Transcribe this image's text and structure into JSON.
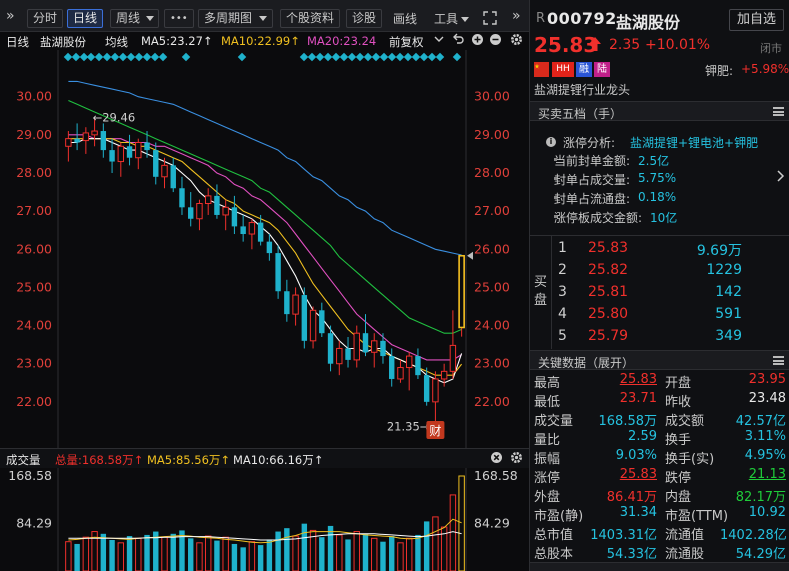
{
  "toolbar": {
    "collapse": "»",
    "intraday": "分时",
    "daily": "日线",
    "weekly": "周线",
    "more_icon": "•••",
    "multi_period": "多周期图",
    "profile": "个股资料",
    "diagnose": "诊股",
    "draw": "画线",
    "tools": "工具",
    "expand_icon": "expand-icon"
  },
  "chart_head": {
    "period": "日线",
    "name": "盐湖股份",
    "avg": "均线",
    "ma5": "MA5:23.27↑",
    "ma10": "MA10:22.99↑",
    "ma20": "MA20:23.24",
    "adjust": "前复权"
  },
  "price_axis": [
    "30.00",
    "29.00",
    "28.00",
    "27.00",
    "26.00",
    "25.00",
    "24.00",
    "23.00",
    "22.00"
  ],
  "annotations": {
    "high": "←29.46",
    "low": "21.35→",
    "finance_badge": "财"
  },
  "volume_head": {
    "label": "成交量",
    "total": "总量:168.58万↑",
    "ma5": "MA5:85.56万↑",
    "ma10": "MA10:66.16万↑"
  },
  "volume_axis": [
    "168.58",
    "84.29"
  ],
  "stock": {
    "market": "R",
    "code": "000792",
    "name": "盐湖股份",
    "add_button": "加自选",
    "price": "25.83",
    "change": "2.35",
    "change_pct": "+10.01%",
    "status": "闭市",
    "tags": [
      "CN",
      "HH",
      "融",
      "陆"
    ],
    "sector_change_label": "钾肥:",
    "sector_change": "+5.98%",
    "concept": "盐湖提锂行业龙头"
  },
  "limit_analysis": {
    "title": "买卖五档（手）",
    "label": "涨停分析:",
    "concepts": "盐湖提锂+锂电池+钾肥",
    "rows": [
      {
        "k": "当前封单金额:",
        "v": "2.5亿"
      },
      {
        "k": "封单占成交量:",
        "v": "5.75%"
      },
      {
        "k": "封单占流通盘:",
        "v": "0.18%"
      },
      {
        "k": "涨停板成交金额:",
        "v": "10亿"
      }
    ]
  },
  "order_book": {
    "side_label": "买盘",
    "rows": [
      {
        "i": "1",
        "p": "25.83",
        "v": "9.69万"
      },
      {
        "i": "2",
        "p": "25.82",
        "v": "1229"
      },
      {
        "i": "3",
        "p": "25.81",
        "v": "142"
      },
      {
        "i": "4",
        "p": "25.80",
        "v": "591"
      },
      {
        "i": "5",
        "p": "25.79",
        "v": "349"
      }
    ]
  },
  "key_data": {
    "title": "关键数据（展开）",
    "rows": [
      {
        "k1": "最高",
        "v1": "25.83",
        "c1": "red",
        "k2": "开盘",
        "v2": "23.95",
        "c2": "red"
      },
      {
        "k1": "最低",
        "v1": "23.71",
        "c1": "red",
        "k2": "昨收",
        "v2": "23.48",
        "c2": "white"
      },
      {
        "k1": "成交量",
        "v1": "168.58万",
        "c1": "cyan",
        "k2": "成交额",
        "v2": "42.57亿",
        "c2": "cyan"
      },
      {
        "k1": "量比",
        "v1": "2.59",
        "c1": "cyan",
        "k2": "换手",
        "v2": "3.11%",
        "c2": "cyan"
      },
      {
        "k1": "振幅",
        "v1": "9.03%",
        "c1": "cyan",
        "k2": "换手(实)",
        "v2": "4.95%",
        "c2": "cyan"
      },
      {
        "k1": "涨停",
        "v1": "25.83",
        "c1": "red",
        "k2": "跌停",
        "v2": "21.13",
        "c2": "green"
      },
      {
        "k1": "外盘",
        "v1": "86.41万",
        "c1": "red",
        "k2": "内盘",
        "v2": "82.17万",
        "c2": "green"
      },
      {
        "k1": "市盈(静)",
        "v1": "31.34",
        "c1": "cyan",
        "k2": "市盈(TTM)",
        "v2": "10.92",
        "c2": "cyan"
      },
      {
        "k1": "总市值",
        "v1": "1403.31亿",
        "c1": "cyan",
        "k2": "流通值",
        "v2": "1402.28亿",
        "c2": "cyan"
      },
      {
        "k1": "总股本",
        "v1": "54.33亿",
        "c1": "cyan",
        "k2": "流通股",
        "v2": "54.29亿",
        "c2": "cyan"
      }
    ]
  },
  "chart_data": {
    "type": "candlestick",
    "ylim": [
      21.0,
      30.7
    ],
    "candles": [
      {
        "o": 28.7,
        "h": 29.1,
        "l": 28.3,
        "c": 28.9
      },
      {
        "o": 28.9,
        "h": 29.3,
        "l": 28.6,
        "c": 28.8
      },
      {
        "o": 28.85,
        "h": 29.2,
        "l": 28.5,
        "c": 29.05
      },
      {
        "o": 29.0,
        "h": 29.46,
        "l": 28.7,
        "c": 29.1
      },
      {
        "o": 29.1,
        "h": 29.3,
        "l": 28.4,
        "c": 28.6
      },
      {
        "o": 28.6,
        "h": 28.9,
        "l": 28.0,
        "c": 28.3
      },
      {
        "o": 28.3,
        "h": 28.8,
        "l": 27.9,
        "c": 28.7
      },
      {
        "o": 28.7,
        "h": 29.0,
        "l": 28.2,
        "c": 28.4
      },
      {
        "o": 28.4,
        "h": 28.9,
        "l": 28.1,
        "c": 28.8
      },
      {
        "o": 28.8,
        "h": 29.1,
        "l": 28.4,
        "c": 28.6
      },
      {
        "o": 28.6,
        "h": 28.8,
        "l": 27.7,
        "c": 27.9
      },
      {
        "o": 27.9,
        "h": 28.4,
        "l": 27.6,
        "c": 28.2
      },
      {
        "o": 28.2,
        "h": 28.4,
        "l": 27.5,
        "c": 27.6
      },
      {
        "o": 27.6,
        "h": 27.9,
        "l": 26.9,
        "c": 27.1
      },
      {
        "o": 27.1,
        "h": 27.5,
        "l": 26.6,
        "c": 26.8
      },
      {
        "o": 26.8,
        "h": 27.3,
        "l": 26.5,
        "c": 27.2
      },
      {
        "o": 27.2,
        "h": 27.6,
        "l": 26.9,
        "c": 27.4
      },
      {
        "o": 27.4,
        "h": 27.7,
        "l": 26.8,
        "c": 26.9
      },
      {
        "o": 26.9,
        "h": 27.3,
        "l": 26.5,
        "c": 27.1
      },
      {
        "o": 27.1,
        "h": 27.4,
        "l": 26.4,
        "c": 26.6
      },
      {
        "o": 26.6,
        "h": 26.9,
        "l": 26.2,
        "c": 26.4
      },
      {
        "o": 26.4,
        "h": 26.8,
        "l": 26.0,
        "c": 26.7
      },
      {
        "o": 26.7,
        "h": 26.9,
        "l": 26.1,
        "c": 26.2
      },
      {
        "o": 26.2,
        "h": 26.4,
        "l": 25.7,
        "c": 25.9
      },
      {
        "o": 25.9,
        "h": 26.1,
        "l": 24.7,
        "c": 24.9
      },
      {
        "o": 24.9,
        "h": 25.2,
        "l": 24.1,
        "c": 24.3
      },
      {
        "o": 24.3,
        "h": 25.0,
        "l": 24.0,
        "c": 24.8
      },
      {
        "o": 24.8,
        "h": 25.0,
        "l": 23.4,
        "c": 23.6
      },
      {
        "o": 23.6,
        "h": 24.5,
        "l": 23.4,
        "c": 24.4
      },
      {
        "o": 24.4,
        "h": 24.6,
        "l": 23.7,
        "c": 23.8
      },
      {
        "o": 23.8,
        "h": 24.0,
        "l": 22.8,
        "c": 23.0
      },
      {
        "o": 23.0,
        "h": 23.6,
        "l": 22.7,
        "c": 23.4
      },
      {
        "o": 23.4,
        "h": 23.7,
        "l": 22.9,
        "c": 23.1
      },
      {
        "o": 23.1,
        "h": 24.0,
        "l": 22.9,
        "c": 23.8
      },
      {
        "o": 23.8,
        "h": 24.3,
        "l": 23.2,
        "c": 23.3
      },
      {
        "o": 23.3,
        "h": 23.8,
        "l": 22.9,
        "c": 23.6
      },
      {
        "o": 23.6,
        "h": 23.8,
        "l": 23.0,
        "c": 23.2
      },
      {
        "o": 23.2,
        "h": 23.4,
        "l": 22.4,
        "c": 22.6
      },
      {
        "o": 22.6,
        "h": 23.1,
        "l": 22.5,
        "c": 22.9
      },
      {
        "o": 22.9,
        "h": 23.3,
        "l": 22.3,
        "c": 23.2
      },
      {
        "o": 23.2,
        "h": 23.4,
        "l": 22.6,
        "c": 22.7
      },
      {
        "o": 22.7,
        "h": 22.9,
        "l": 21.9,
        "c": 22.0
      },
      {
        "o": 22.0,
        "h": 22.8,
        "l": 21.35,
        "c": 22.6
      },
      {
        "o": 22.6,
        "h": 23.0,
        "l": 22.4,
        "c": 22.8
      },
      {
        "o": 22.8,
        "h": 24.4,
        "l": 22.6,
        "c": 23.48
      },
      {
        "o": 23.95,
        "h": 25.83,
        "l": 23.71,
        "c": 25.83
      }
    ],
    "ma_series": [
      {
        "name": "MA5",
        "color": "#ffffff",
        "values": [
          28.8,
          28.8,
          28.9,
          28.9,
          28.9,
          28.8,
          28.7,
          28.6,
          28.6,
          28.5,
          28.4,
          28.3,
          28.2,
          28.0,
          27.8,
          27.5,
          27.3,
          27.2,
          27.1,
          27.0,
          26.9,
          26.8,
          26.6,
          26.4,
          26.1,
          25.7,
          25.3,
          24.8,
          24.4,
          24.2,
          23.9,
          23.6,
          23.4,
          23.4,
          23.3,
          23.4,
          23.4,
          23.2,
          23.1,
          23.0,
          22.9,
          22.7,
          22.6,
          22.5,
          22.6,
          23.27
        ]
      },
      {
        "name": "MA10",
        "color": "#f0c020",
        "values": [
          28.9,
          28.9,
          28.9,
          28.9,
          28.9,
          28.9,
          28.8,
          28.8,
          28.7,
          28.7,
          28.6,
          28.5,
          28.4,
          28.3,
          28.1,
          27.9,
          27.7,
          27.5,
          27.3,
          27.2,
          27.0,
          26.9,
          26.8,
          26.7,
          26.5,
          26.2,
          25.9,
          25.5,
          25.1,
          24.8,
          24.5,
          24.2,
          23.9,
          23.7,
          23.5,
          23.4,
          23.3,
          23.2,
          23.1,
          23.0,
          22.9,
          22.8,
          22.7,
          22.7,
          22.7,
          22.99
        ]
      },
      {
        "name": "MA20",
        "color": "#e050c0",
        "values": [
          29.0,
          29.0,
          29.0,
          28.9,
          28.9,
          28.9,
          28.9,
          28.8,
          28.8,
          28.8,
          28.7,
          28.7,
          28.6,
          28.5,
          28.4,
          28.3,
          28.2,
          28.0,
          27.9,
          27.7,
          27.6,
          27.4,
          27.3,
          27.1,
          26.9,
          26.7,
          26.4,
          26.1,
          25.8,
          25.5,
          25.2,
          24.9,
          24.6,
          24.3,
          24.1,
          23.9,
          23.7,
          23.5,
          23.4,
          23.3,
          23.2,
          23.1,
          23.1,
          23.1,
          23.1,
          23.24
        ]
      },
      {
        "name": "MA30",
        "color": "#20c040",
        "values": [
          29.9,
          29.8,
          29.7,
          29.6,
          29.5,
          29.4,
          29.3,
          29.2,
          29.1,
          29.0,
          28.9,
          28.8,
          28.7,
          28.6,
          28.5,
          28.4,
          28.3,
          28.2,
          28.1,
          28.0,
          27.9,
          27.8,
          27.6,
          27.5,
          27.3,
          27.1,
          26.9,
          26.7,
          26.5,
          26.3,
          26.1,
          25.8,
          25.6,
          25.4,
          25.2,
          25.0,
          24.8,
          24.6,
          24.4,
          24.2,
          24.1,
          24.0,
          23.9,
          23.8,
          23.8,
          23.9
        ]
      },
      {
        "name": "MA60",
        "color": "#3a8fe0",
        "values": [
          30.4,
          30.4,
          30.35,
          30.3,
          30.25,
          30.2,
          30.15,
          30.1,
          30.0,
          29.95,
          29.9,
          29.85,
          29.8,
          29.7,
          29.6,
          29.5,
          29.4,
          29.3,
          29.2,
          29.1,
          29.0,
          28.9,
          28.8,
          28.7,
          28.6,
          28.4,
          28.3,
          28.1,
          27.9,
          27.8,
          27.6,
          27.4,
          27.3,
          27.1,
          27.0,
          26.8,
          26.7,
          26.5,
          26.4,
          26.3,
          26.2,
          26.1,
          26.0,
          25.95,
          25.9,
          25.85
        ]
      }
    ],
    "volume": {
      "ylim": [
        0,
        168.58
      ],
      "values": [
        52,
        48,
        60,
        70,
        66,
        55,
        50,
        62,
        58,
        64,
        70,
        60,
        66,
        72,
        58,
        50,
        62,
        54,
        60,
        48,
        42,
        52,
        46,
        56,
        70,
        76,
        62,
        84,
        72,
        60,
        80,
        64,
        56,
        70,
        66,
        58,
        52,
        62,
        50,
        58,
        64,
        88,
        96,
        78,
        135,
        168.58
      ],
      "ma5": [
        55,
        56,
        58,
        60,
        59,
        58,
        57,
        56,
        58,
        59,
        60,
        61,
        62,
        63,
        62,
        60,
        59,
        58,
        56,
        55,
        53,
        51,
        50,
        51,
        55,
        60,
        63,
        68,
        70,
        70,
        70,
        70,
        68,
        66,
        64,
        63,
        62,
        61,
        58,
        57,
        58,
        63,
        70,
        77,
        92,
        85.56
      ],
      "ma10": [
        58,
        58,
        58,
        58,
        58,
        58,
        58,
        58,
        58,
        59,
        59,
        60,
        60,
        61,
        61,
        61,
        61,
        60,
        59,
        58,
        57,
        56,
        55,
        55,
        55,
        56,
        57,
        59,
        61,
        63,
        64,
        65,
        66,
        66,
        66,
        66,
        65,
        64,
        63,
        62,
        61,
        62,
        64,
        66,
        70,
        66.16
      ]
    }
  }
}
